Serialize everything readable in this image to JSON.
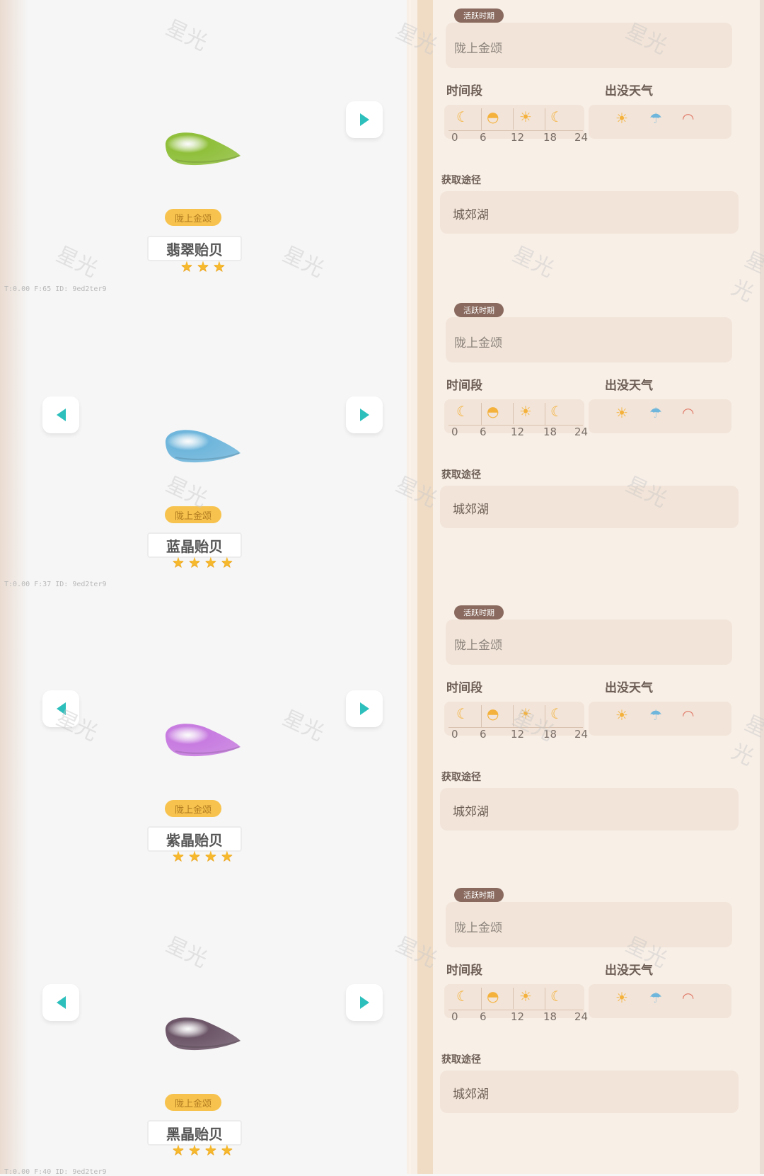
{
  "watermark": "星光",
  "colors": {
    "accent_teal": "#2cbfbc",
    "tag_yellow": "#f7c34e",
    "star": "#f6b82c",
    "badge_brown": "#8a6a5e"
  },
  "items": [
    {
      "name": "翡翠贻贝",
      "tag": "陇上金颂",
      "stars": 3,
      "color": "#8fbf3a",
      "debug": "T:0.00   F:65   ID: 9ed2ter9",
      "prev": false
    },
    {
      "name": "蓝晶贻贝",
      "tag": "陇上金颂",
      "stars": 4,
      "color": "#6fb6dc",
      "debug": "T:0.00   F:37   ID: 9ed2ter9",
      "prev": true
    },
    {
      "name": "紫晶贻贝",
      "tag": "陇上金颂",
      "stars": 4,
      "color": "#c77be0",
      "debug": "",
      "prev": true
    },
    {
      "name": "黑晶贻贝",
      "tag": "陇上金颂",
      "stars": 4,
      "color": "#6c5668",
      "debug": "T:0.00   F:40   ID: 9ed2ter9",
      "prev": true
    }
  ],
  "details": {
    "active_badge": "活跃时期",
    "active_period": "陇上金颂",
    "time_label": "时间段",
    "weather_label": "出没天气",
    "source_label": "获取途径",
    "source": "城郊湖",
    "time_ticks": [
      "0",
      "6",
      "12",
      "18",
      "24"
    ],
    "time_icons": [
      "moon-icon",
      "sunrise-icon",
      "sun-icon",
      "moon-icon"
    ],
    "weather_icons": [
      "sunny-icon",
      "rain-icon",
      "rainbow-icon"
    ]
  }
}
